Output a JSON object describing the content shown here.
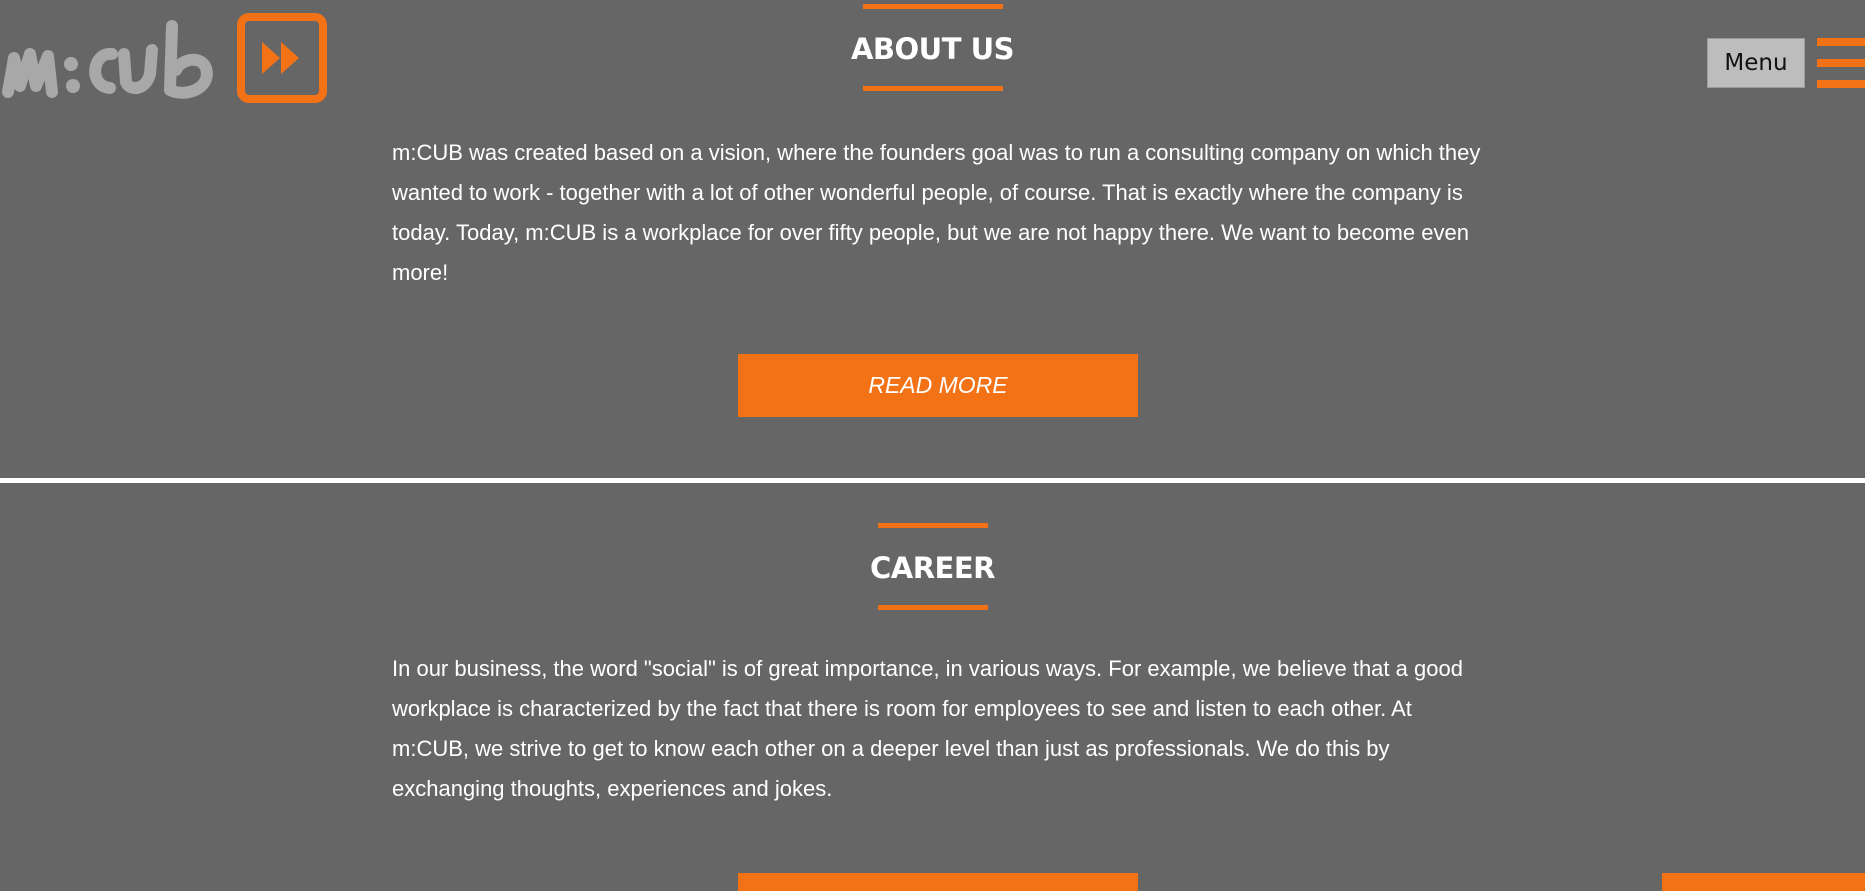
{
  "header": {
    "logo_alt": "m:cub",
    "menu_label": "Menu"
  },
  "about": {
    "title": "ABOUT US",
    "text": "m:CUB was created based on a vision, where the founders goal was to run a consulting company on which they wanted to work - together with a lot of other wonderful people, of course. That is exactly where the company is today. Today, m:CUB is a workplace for over fifty people, but we are not happy there. We want to become even more!",
    "button_label": "READ MORE"
  },
  "career": {
    "title": "CAREER",
    "text": "In our business, the word \"social\" is of great importance, in various ways. For example, we believe that a good workplace is characterized by the fact that there is room for employees to see and listen to each other. At m:CUB, we strive to get to know each other on a deeper level than just as professionals. We do this by exchanging thoughts, experiences and jokes."
  },
  "colors": {
    "background": "#666666",
    "accent": "#f47216",
    "text": "#ffffff",
    "menu_button": "#bdbdbd"
  }
}
